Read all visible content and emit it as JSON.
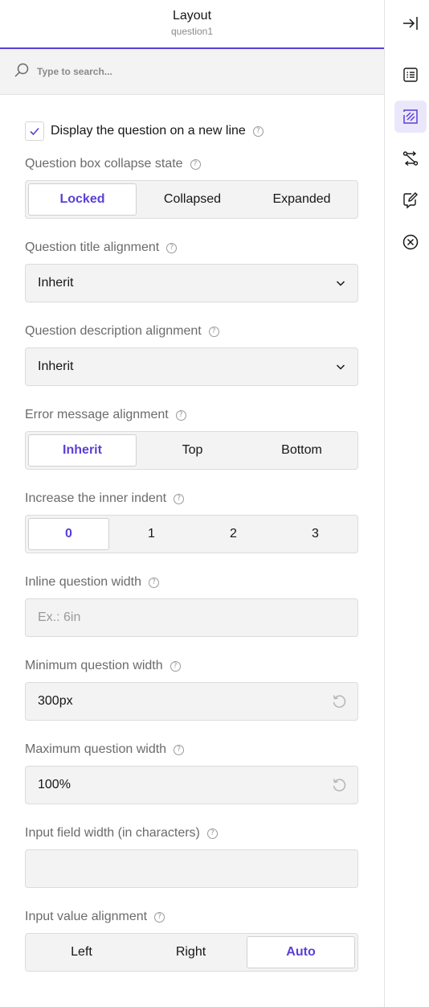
{
  "header": {
    "title": "Layout",
    "subtitle": "question1"
  },
  "search": {
    "placeholder": "Type to search..."
  },
  "display_new_line": {
    "label": "Display the question on a new line",
    "checked": true
  },
  "collapse_state": {
    "label": "Question box collapse state",
    "options": [
      "Locked",
      "Collapsed",
      "Expanded"
    ],
    "selected": "Locked"
  },
  "title_alignment": {
    "label": "Question title alignment",
    "value": "Inherit"
  },
  "description_alignment": {
    "label": "Question description alignment",
    "value": "Inherit"
  },
  "error_alignment": {
    "label": "Error message alignment",
    "options": [
      "Inherit",
      "Top",
      "Bottom"
    ],
    "selected": "Inherit"
  },
  "inner_indent": {
    "label": "Increase the inner indent",
    "options": [
      "0",
      "1",
      "2",
      "3"
    ],
    "selected": "0"
  },
  "inline_width": {
    "label": "Inline question width",
    "placeholder": "Ex.: 6in",
    "value": ""
  },
  "min_width": {
    "label": "Minimum question width",
    "value": "300px"
  },
  "max_width": {
    "label": "Maximum question width",
    "value": "100%"
  },
  "input_field_width": {
    "label": "Input field width (in characters)",
    "value": ""
  },
  "input_value_alignment": {
    "label": "Input value alignment",
    "options": [
      "Left",
      "Right",
      "Auto"
    ],
    "selected": "Auto"
  },
  "help_glyph": "?",
  "rail": {
    "items": [
      "collapse-panel-icon",
      "general-list-icon",
      "layout-icon",
      "logic-icon",
      "validation-icon",
      "clear-icon"
    ],
    "active": "layout-icon"
  },
  "colors": {
    "accent": "#5b3fd6",
    "accent_bg": "#ebe7fb",
    "field_bg": "#f3f3f3",
    "label": "#6b6b6b"
  }
}
